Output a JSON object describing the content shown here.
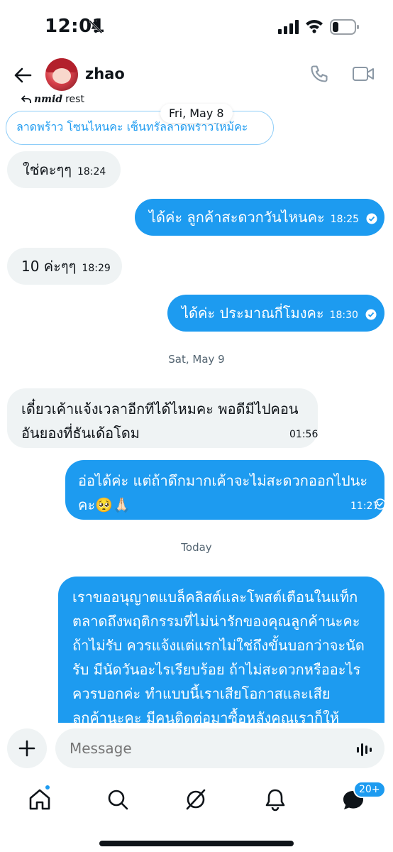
{
  "status": {
    "time": "12:01"
  },
  "header": {
    "name": "zhao",
    "reply_styled": "𝒏𝒎𝒊𝒅",
    "reply_text": "rest"
  },
  "quoted": {
    "text": "ลาดพร้าว โซนไหนคะ เซ็นทรัลลาดพร้าวใหม้คะ"
  },
  "date_float": "Fri, May 8",
  "messages": [
    {
      "dir": "in",
      "text": "ใช่คะๆๆ",
      "time": "18:24"
    },
    {
      "dir": "out",
      "text": "ได้ค่ะ ลูกค้าสะดวกวันไหนคะ",
      "time": "18:25"
    },
    {
      "dir": "in",
      "text": "10 ค่ะๆๆ",
      "time": "18:29"
    },
    {
      "dir": "out",
      "text": "ได้ค่ะ ประมาณกี่โมงคะ",
      "time": "18:30"
    },
    {
      "dir": "in",
      "line1": "เดี๋ยวเค้าแจ้งเวลาอีกทีได้ไหมคะ พอดีมีไปคอน",
      "line2": "อันยองที่ธันเด้อโดม",
      "time": "01:56"
    },
    {
      "dir": "out",
      "line1": "อ่อได้ค่ะ แต่ถ้าดึกมากเค้าจะไม่สะดวกออกไปนะ",
      "line2": "คะ🥺🙏🏻",
      "time": "11:27"
    },
    {
      "dir": "out",
      "lines": [
        "เราขออนุญาตแบล็คลิสต์และโพสต์เตือนในแท็ก",
        "ตลาดถึงพฤติกรรมที่ไม่น่ารักของคุณลูกค้านะคะ",
        "ถ้าไม่รับ ควรแจ้งแต่แรกไม่ใช่ถึงขั้นบอกว่าจะนัด",
        "รับ มีนัดวันอะไรเรียบร้อย ถ้าไม่สะดวกหรืออะไร",
        "ควรบอกค่ะ ทำแบบนี้เราเสียโอกาสและเสีย",
        "ลูกค้านะคะ มีคนติดต่อมาซื้อหลังคุณเราก็ให้"
      ]
    }
  ],
  "date_separators": {
    "sat": "Sat, May 9",
    "today": "Today"
  },
  "composer": {
    "placeholder": "Message"
  },
  "tabbar": {
    "messages_badge": "20+"
  },
  "colors": {
    "accent": "#1d9bf0",
    "incoming_bg": "#eff3f4"
  }
}
